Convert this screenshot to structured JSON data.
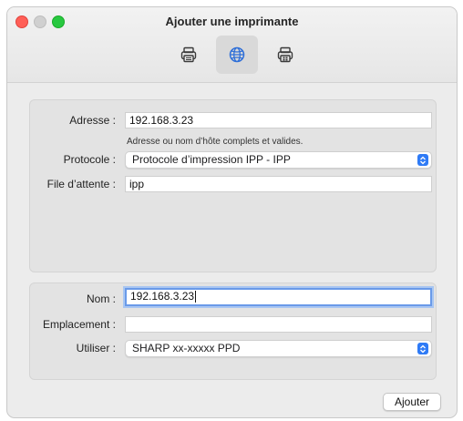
{
  "window": {
    "title": "Ajouter une imprimante"
  },
  "toolbar": {
    "items": [
      {
        "icon": "printer-icon"
      },
      {
        "icon": "globe-icon",
        "selected": true
      },
      {
        "icon": "printer-windows-icon"
      }
    ]
  },
  "connection": {
    "address_label": "Adresse :",
    "address_value": "192.168.3.23",
    "address_hint": "Adresse ou nom d’hôte complets et valides.",
    "protocol_label": "Protocole :",
    "protocol_value": "Protocole d’impression IPP - IPP",
    "queue_label": "File d’attente :",
    "queue_value": "ipp"
  },
  "details": {
    "name_label": "Nom :",
    "name_value": "192.168.3.23",
    "location_label": "Emplacement :",
    "location_value": "",
    "use_label": "Utiliser :",
    "use_value": "SHARP xx-xxxxx PPD"
  },
  "footer": {
    "add_button": "Ajouter"
  },
  "colors": {
    "accent": "#2f7bf6",
    "focus_ring": "#6a9ae8",
    "close": "#ff5f57",
    "maximize": "#28c840"
  }
}
